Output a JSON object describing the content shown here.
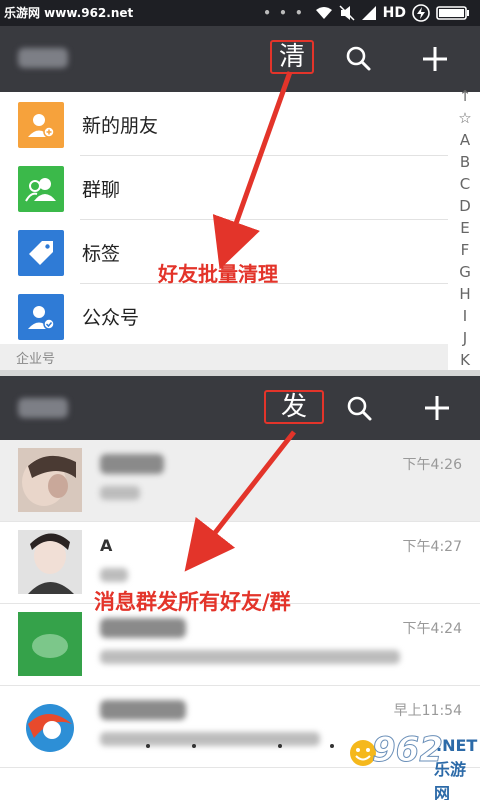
{
  "status_bar": {
    "watermark": "乐游网 www.962.net",
    "network": "HD"
  },
  "contacts_bar": {
    "action_label": "清"
  },
  "contacts": {
    "items": [
      {
        "label": "新的朋友",
        "icon": "add-friend-icon",
        "color": "#f6a23c"
      },
      {
        "label": "群聊",
        "icon": "group-chat-icon",
        "color": "#3bb94a"
      },
      {
        "label": "标签",
        "icon": "tag-icon",
        "color": "#2f7bd6"
      },
      {
        "label": "公众号",
        "icon": "official-account-icon",
        "color": "#2f7bd6"
      }
    ],
    "section_header": "企业号"
  },
  "index_bar": {
    "letters": [
      "↑",
      "☆",
      "A",
      "B",
      "C",
      "D",
      "E",
      "F",
      "G",
      "H",
      "I",
      "J",
      "K"
    ]
  },
  "chats_bar": {
    "action_label": "发"
  },
  "chats": {
    "items": [
      {
        "time": "下午4:26"
      },
      {
        "name": "A",
        "time": "下午4:27"
      },
      {
        "time": "下午4:24"
      },
      {
        "time": "早上11:54"
      }
    ]
  },
  "annotations": {
    "top": "好友批量清理",
    "bottom": "消息群发所有好友/群"
  },
  "brand": {
    "number": "962",
    "suffix": ".NET",
    "cn": "乐游网"
  },
  "colors": {
    "app_bar": "#393a3f",
    "status_bar": "#1e1f24",
    "annotation": "#e3342a"
  }
}
